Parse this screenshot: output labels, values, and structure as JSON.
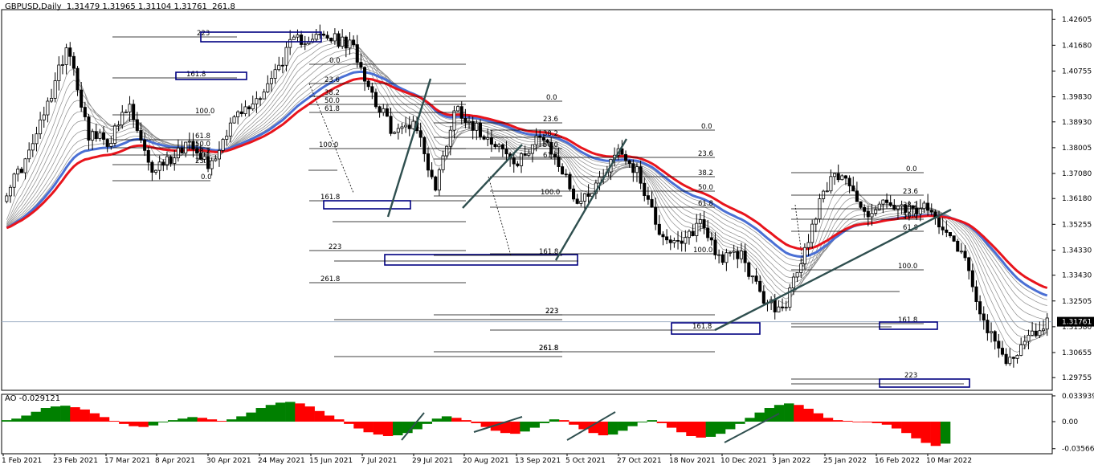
{
  "header": {
    "symbol": "GBPUSD,Daily",
    "ohlc": "1.31479 1.31965 1.31104 1.31761",
    "extra": "261.8"
  },
  "indicator": {
    "name": "AO",
    "value": "-0.029121"
  },
  "chart_data": {
    "type": "candlestick",
    "ylim": [
      1.293,
      1.429
    ],
    "y_ticks": [
      "1.42605",
      "1.41680",
      "1.40755",
      "1.39830",
      "1.38930",
      "1.38005",
      "1.37080",
      "1.36180",
      "1.35255",
      "1.34330",
      "1.33430",
      "1.32505",
      "1.31580",
      "1.30655",
      "1.29755"
    ],
    "current_price": "1.31761",
    "x_labels": [
      "1 Feb 2021",
      "23 Feb 2021",
      "17 Mar 2021",
      "8 Apr 2021",
      "30 Apr 2021",
      "24 May 2021",
      "15 Jun 2021",
      "7 Jul 2021",
      "29 Jul 2021",
      "20 Aug 2021",
      "13 Sep 2021",
      "5 Oct 2021",
      "27 Oct 2021",
      "18 Nov 2021",
      "10 Dec 2021",
      "3 Jan 2022",
      "25 Jan 2022",
      "16 Feb 2022",
      "10 Mar 2022"
    ],
    "price_path": [
      1.365,
      1.376,
      1.395,
      1.418,
      1.385,
      1.382,
      1.395,
      1.372,
      1.376,
      1.383,
      1.373,
      1.39,
      1.395,
      1.405,
      1.418,
      1.42,
      1.419,
      1.416,
      1.398,
      1.385,
      1.39,
      1.365,
      1.395,
      1.387,
      1.382,
      1.373,
      1.385,
      1.375,
      1.36,
      1.368,
      1.38,
      1.37,
      1.35,
      1.344,
      1.354,
      1.34,
      1.342,
      1.326,
      1.321,
      1.34,
      1.365,
      1.372,
      1.356,
      1.36,
      1.357,
      1.358,
      1.352,
      1.34,
      1.315,
      1.303,
      1.311,
      1.3176
    ],
    "ema_red_path": [
      1.345,
      1.353,
      1.368,
      1.383,
      1.388,
      1.386,
      1.382,
      1.38,
      1.378,
      1.373,
      1.364,
      1.355,
      1.349,
      1.35,
      1.352,
      1.348,
      1.342
    ],
    "ao_ylim": [
      -0.037,
      0.036
    ],
    "ao_ticks": [
      "0.033939",
      "0.00",
      "-0.035669"
    ],
    "ao_values": [
      0.002,
      0.004,
      0.008,
      0.013,
      0.018,
      0.02,
      0.021,
      0.019,
      0.016,
      0.011,
      0.006,
      0.001,
      -0.003,
      -0.006,
      -0.007,
      -0.005,
      -0.001,
      0.002,
      0.004,
      0.006,
      0.005,
      0.003,
      0.001,
      0.003,
      0.007,
      0.012,
      0.018,
      0.022,
      0.025,
      0.026,
      0.024,
      0.02,
      0.014,
      0.008,
      0.003,
      -0.003,
      -0.009,
      -0.014,
      -0.017,
      -0.019,
      -0.018,
      -0.015,
      -0.01,
      -0.003,
      0.004,
      0.007,
      0.005,
      0.002,
      -0.002,
      -0.007,
      -0.012,
      -0.015,
      -0.016,
      -0.013,
      -0.008,
      -0.002,
      0.003,
      0.002,
      -0.004,
      -0.01,
      -0.015,
      -0.018,
      -0.017,
      -0.012,
      -0.006,
      -0.001,
      0.002,
      -0.002,
      -0.008,
      -0.014,
      -0.019,
      -0.021,
      -0.02,
      -0.016,
      -0.01,
      -0.003,
      0.005,
      0.012,
      0.018,
      0.022,
      0.024,
      0.022,
      0.017,
      0.011,
      0.005,
      0.002,
      0.001,
      0.0,
      -0.001,
      -0.002,
      -0.004,
      -0.009,
      -0.015,
      -0.022,
      -0.028,
      -0.032,
      -0.029
    ],
    "fib_labels": {
      "a": [
        "223",
        "161.8"
      ],
      "b": [
        "0.0",
        "23.6",
        "38.2",
        "50.0",
        "61.8",
        "100.0"
      ],
      "c": [
        "0.0",
        "23.6",
        "38.2",
        "50.0",
        "61.8",
        "100.0",
        "161.8",
        "223",
        "261.8"
      ],
      "d": [
        "0.0",
        "23.6",
        "38.2",
        "50.0",
        "61.8",
        "100.0",
        "161.8",
        "223",
        "261.8"
      ],
      "e": [
        "0.0",
        "23.6",
        "38.2",
        "50.0",
        "61.8",
        "100.0",
        "161.8",
        "223",
        "261.8"
      ],
      "f": [
        "0.0",
        "23.6",
        "38.2",
        "50.0",
        "61.8",
        "100.0",
        "161.8",
        "223"
      ]
    },
    "colors": {
      "bull": "#000000",
      "bear": "#000000",
      "bull_body": "#ffffff",
      "ema_red": "#e8141c",
      "ema_blue": "#4a6fd4",
      "ema_thin": "#8a8a8a",
      "box": "#000080",
      "trend": "#2f4f4f",
      "ao_up": "#008000",
      "ao_down": "#ff0000",
      "price_line": "#a0b0c4"
    }
  }
}
